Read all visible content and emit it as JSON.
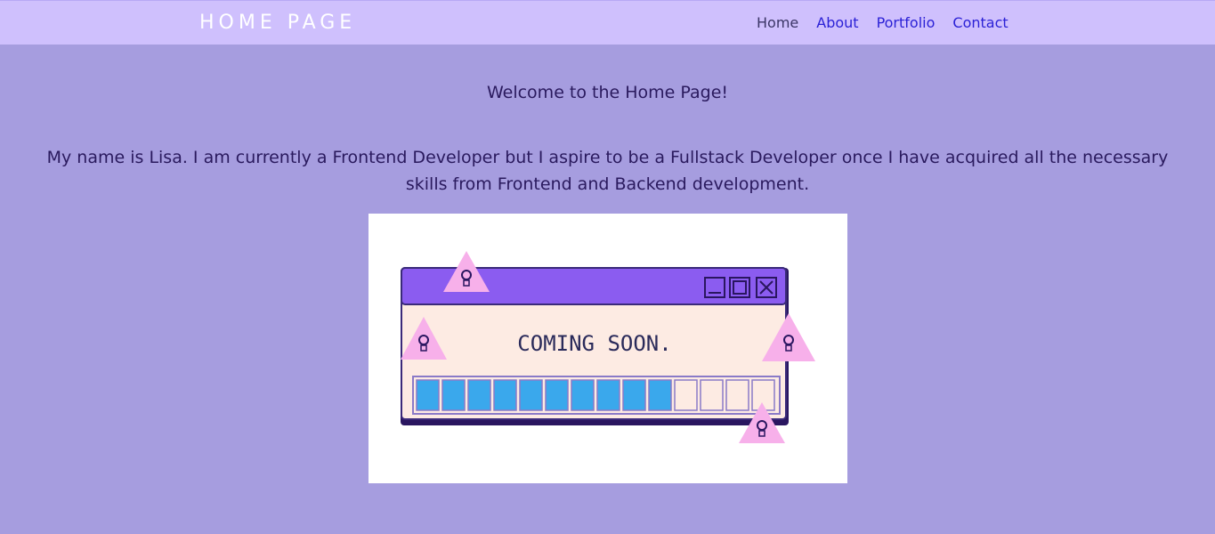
{
  "header": {
    "title": "HOME PAGE",
    "nav": [
      {
        "label": "Home",
        "current": true
      },
      {
        "label": "About",
        "current": false
      },
      {
        "label": "Portfolio",
        "current": false
      },
      {
        "label": "Contact",
        "current": false
      }
    ]
  },
  "main": {
    "welcome": "Welcome to the Home Page!",
    "intro": "My name is Lisa. I am currently a Frontend Developer but I aspire to be a Fullstack Developer once I have acquired all the necessary skills from Frontend and Backend development.",
    "image": {
      "text": "COMING SOON.",
      "progress_filled": 10,
      "progress_total": 14
    }
  },
  "colors": {
    "page_bg": "#a69ddf",
    "navbar_bg": "#cfc0fd",
    "link": "#2b21d6",
    "window_titlebar": "#8b5cf0",
    "window_body": "#fdebe3",
    "progress_fill": "#3aa8ec",
    "warning_triangle": "#f7b0ea"
  }
}
